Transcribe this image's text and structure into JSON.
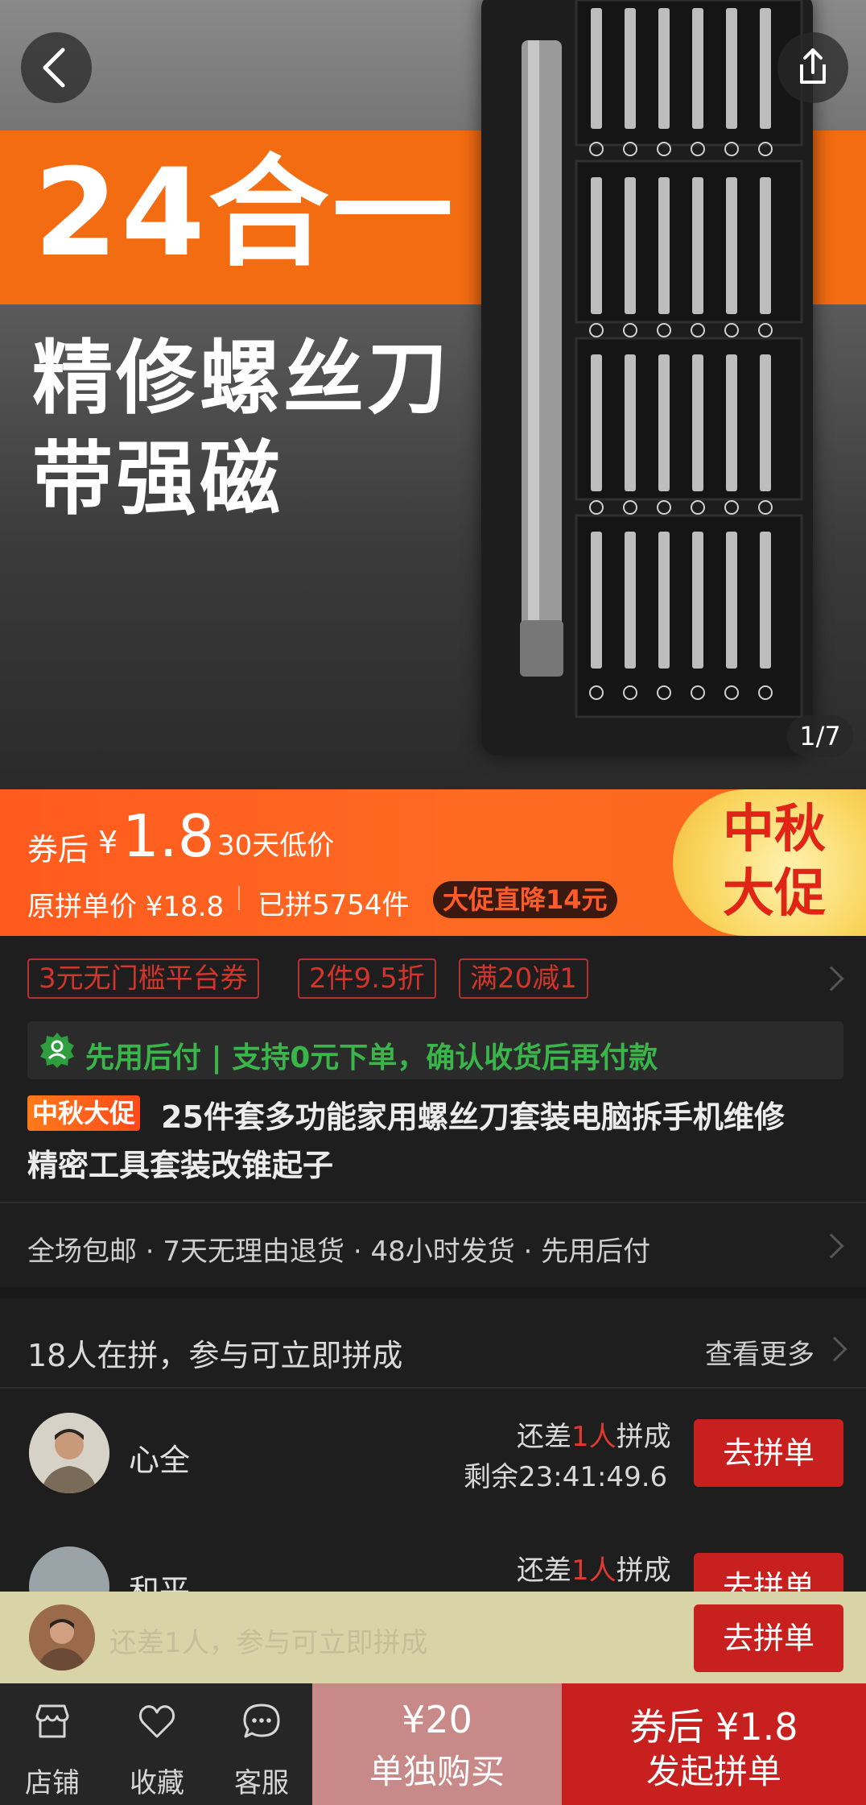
{
  "hero": {
    "headline": "24合一",
    "line1": "精修螺丝刀",
    "line2": "带强磁",
    "page_indicator": "1/7"
  },
  "price_bar": {
    "after_coupon_label": "券后",
    "currency": "¥",
    "price": "1.8",
    "lowest_label": "30天低价",
    "original_price": "原拼单价 ¥18.8",
    "sold": "已拼5754件",
    "promo_pill": "大促直降14元",
    "festival_line1": "中秋",
    "festival_line2": "大促"
  },
  "coupons": [
    "3元无门槛平台券",
    "2件9.5折",
    "满20减1"
  ],
  "pay_later": {
    "text": "先用后付 | 支持0元下单，确认收货后再付款"
  },
  "product": {
    "tag": "中秋大促",
    "title_line1": "25件套多功能家用螺丝刀套装电脑拆手机维修",
    "title_line2": "精密工具套装改锥起子"
  },
  "services": "全场包邮 · 7天无理由退货 · 48小时发货 · 先用后付",
  "group": {
    "header": "18人在拼，参与可立即拼成",
    "see_more": "查看更多",
    "rows": [
      {
        "name": "心全",
        "need_prefix": "还差",
        "need_count": "1人",
        "need_suffix": "拼成",
        "remaining": "剩余23:41:49.6",
        "button": "去拼单"
      },
      {
        "name": "和平",
        "need_prefix": "还差",
        "need_count": "1人",
        "need_suffix": "拼成",
        "remaining": "",
        "button": "去拼单"
      }
    ]
  },
  "sticky": {
    "text": "还差1人，参与可立即拼成",
    "button": "去拼单"
  },
  "bottom_bar": {
    "tabs": [
      "店铺",
      "收藏",
      "客服"
    ],
    "single_price": "¥20",
    "single_label": "单独购买",
    "group_price": "券后 ¥1.8",
    "group_label": "发起拼单"
  }
}
